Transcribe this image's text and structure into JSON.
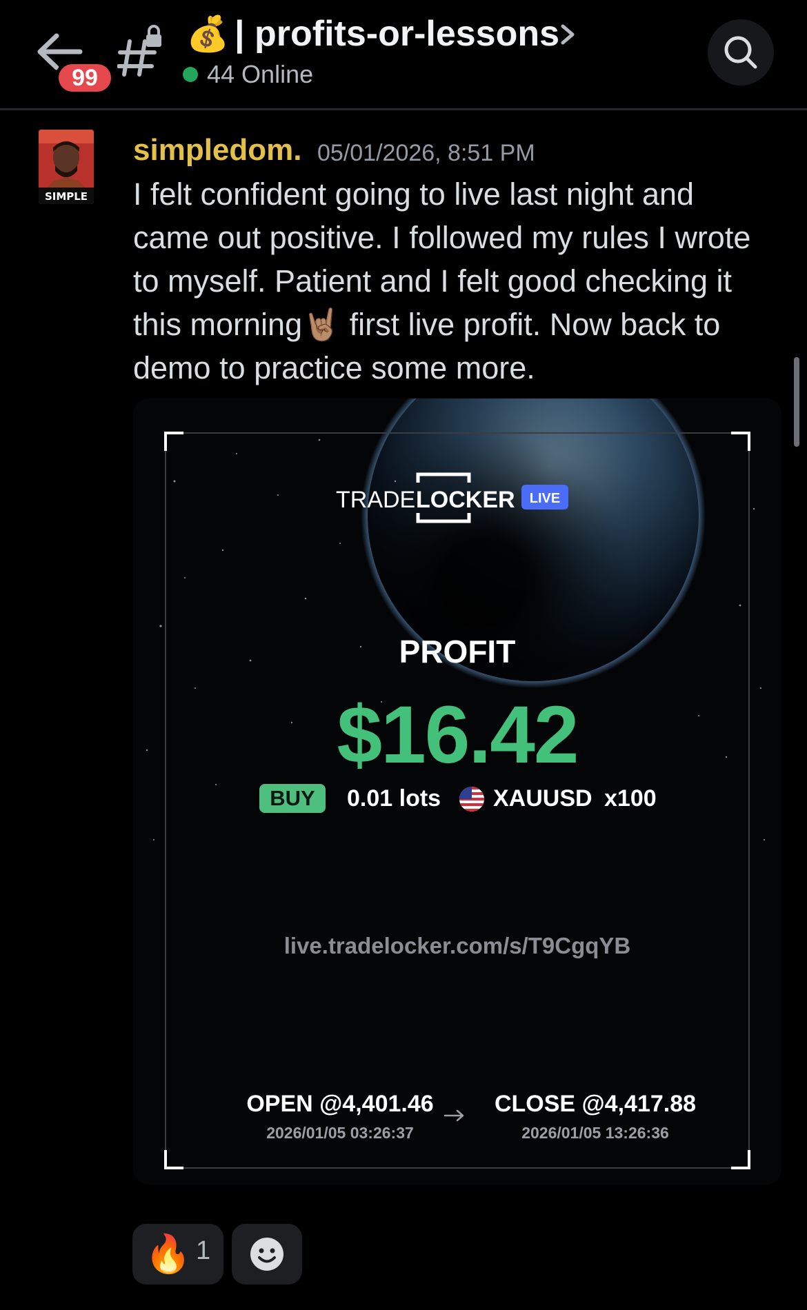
{
  "header": {
    "unread_badge": "99",
    "channel_emoji": "💰",
    "channel_name": "| profits-or-lessons",
    "online_text": "44 Online"
  },
  "message": {
    "username": "simpledom.",
    "timestamp": "05/01/2026, 8:51 PM",
    "text_part1": "I felt confident going to live last night and came out positive. I followed my rules I wrote to myself. Patient and I felt good checking it this morning",
    "text_emoji": "🤘🏽",
    "text_part2": " first live profit. Now back to demo to practice some more.",
    "avatar_label": "SIMPLE"
  },
  "card": {
    "brand_left": "TRADE",
    "brand_right": "LOCKER",
    "brand_tag": "LIVE",
    "profit_label": "PROFIT",
    "profit_value": "$16.42",
    "side": "BUY",
    "lots": "0.01 lots",
    "symbol": "XAUUSD",
    "multiplier": "x100",
    "share_link": "live.tradelocker.com/s/T9CgqYB",
    "open_label": "OPEN @4,401.46",
    "open_time": "2026/01/05 03:26:37",
    "close_label": "CLOSE @4,417.88",
    "close_time": "2026/01/05 13:26:36"
  },
  "reactions": [
    {
      "emoji": "🔥",
      "count": "1"
    }
  ],
  "colors": {
    "background": "#000000",
    "username": "#e3c04a",
    "profit": "#43c07a",
    "badge": "#e5484d",
    "online": "#23a55a",
    "live_tag": "#4a6cf7"
  }
}
